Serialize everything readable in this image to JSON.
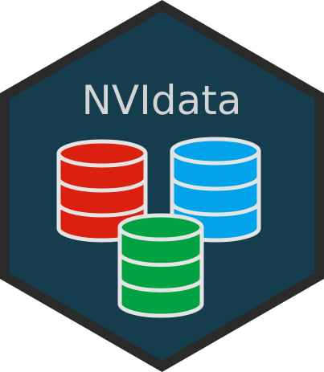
{
  "logo": {
    "title": "NVIdata",
    "colors": {
      "border": "#2a2a2a",
      "background": "#163d4e",
      "title": "#d4d4d4",
      "outline": "#e4e4e4",
      "db_red": "#dc2010",
      "db_blue": "#02a3ea",
      "db_green": "#02a142"
    },
    "databases": [
      {
        "name": "red-database-icon",
        "color_key": "db_red"
      },
      {
        "name": "blue-database-icon",
        "color_key": "db_blue"
      },
      {
        "name": "green-database-icon",
        "color_key": "db_green"
      }
    ]
  }
}
